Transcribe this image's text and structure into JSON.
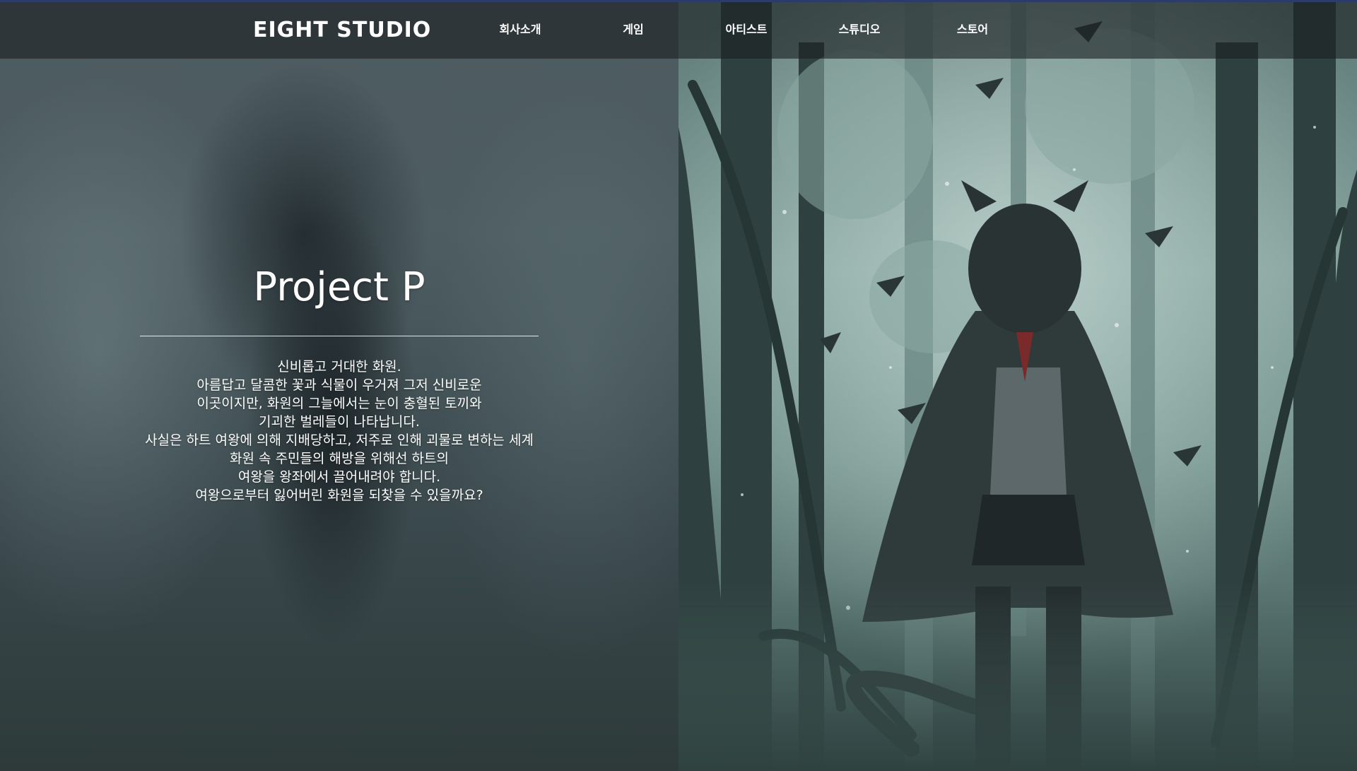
{
  "header": {
    "logo": "EIGHT STUDIO",
    "nav": [
      {
        "label": "회사소개"
      },
      {
        "label": "게임"
      },
      {
        "label": "아티스트"
      },
      {
        "label": "스튜디오"
      },
      {
        "label": "스토어"
      }
    ]
  },
  "main": {
    "title": "Project P",
    "description": [
      "신비롭고 거대한 화원.",
      "아름답고 달콤한 꽃과 식물이 우거져 그저 신비로운",
      "이곳이지만, 화원의 그늘에서는 눈이 충혈된 토끼와",
      "기괴한 벌레들이 나타납니다.",
      "사실은 하트 여왕에 의해 지배당하고, 저주로 인해 괴물로 변하는 세계",
      "화원 속 주민들의 해방을 위해선 하트의",
      "여왕을 왕좌에서 끌어내려야 합니다.",
      "여왕으로부터 잃어버린 화원을 되찾을 수 있을까요?"
    ]
  },
  "artwork": {
    "subject": "cat-eared girl in hooded cloak standing in misty forest"
  }
}
